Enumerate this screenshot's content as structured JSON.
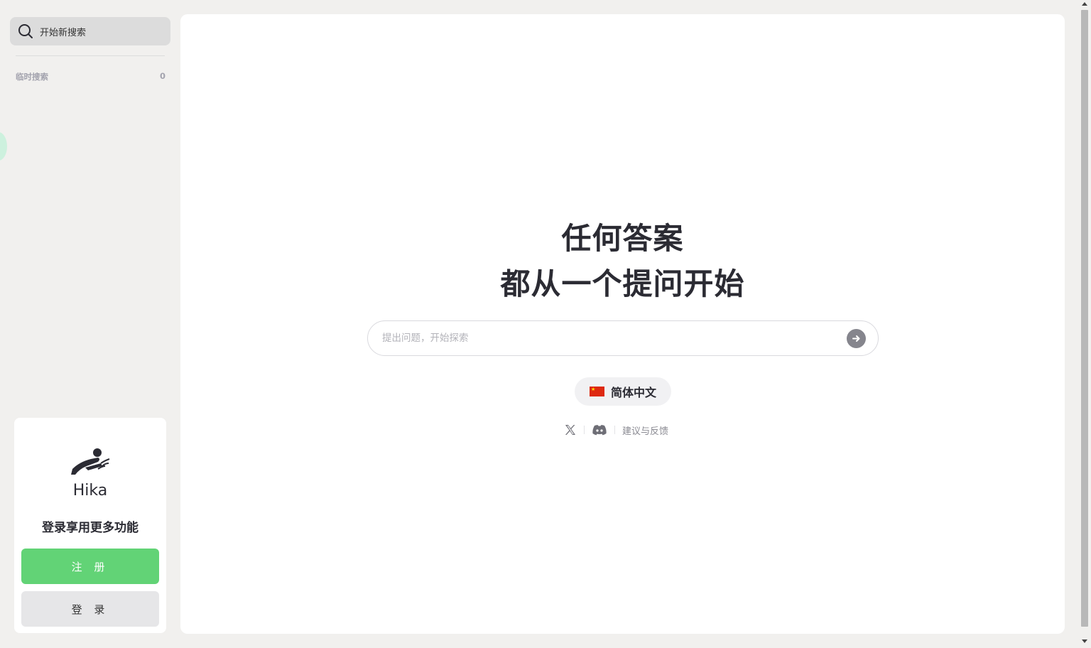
{
  "sidebar": {
    "new_search_label": "开始新搜索",
    "temp_search": {
      "label": "临时搜索",
      "count": "0"
    }
  },
  "login_card": {
    "brand": "Hika",
    "prompt": "登录享用更多功能",
    "signup_label": "注 册",
    "login_label": "登 录"
  },
  "main": {
    "headline_line1": "任何答案",
    "headline_line2": "都从一个提问开始",
    "ask_placeholder": "提出问题，开始探索",
    "language": "简体中文",
    "feedback_label": "建议与反馈"
  },
  "colors": {
    "accent_green": "#62d376",
    "background": "#f1f0ee",
    "text_dark": "#2b2b33"
  },
  "icons": [
    "search-icon",
    "arrow-right-icon",
    "china-flag-icon",
    "x-logo-icon",
    "discord-icon"
  ]
}
